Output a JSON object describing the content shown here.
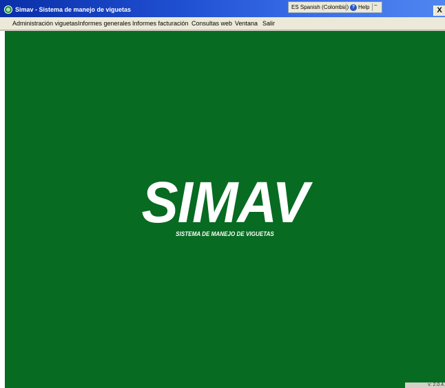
{
  "window": {
    "title": "Simav - Sistema de manejo de viguetas",
    "close_label": "X"
  },
  "language_bar": {
    "language": "ES Spanish (Colombia)",
    "help_label": "Help",
    "help_icon": "help-icon",
    "options_label": "–"
  },
  "menu": {
    "items": [
      {
        "label": "Administración viguetas"
      },
      {
        "label": "Informes generales"
      },
      {
        "label": "Informes facturación"
      },
      {
        "label": "Consultas web"
      },
      {
        "label": "Ventana"
      },
      {
        "label": "Salir"
      }
    ]
  },
  "logo": {
    "main": "SIMAV",
    "subtitle": "SISTEMA DE MANEJO DE VIGUETAS"
  },
  "status": {
    "version": "v: 2.0.4."
  },
  "colors": {
    "background": "#076b21",
    "titlebar": "#1f4fd1",
    "menubar": "#ece9d8"
  }
}
